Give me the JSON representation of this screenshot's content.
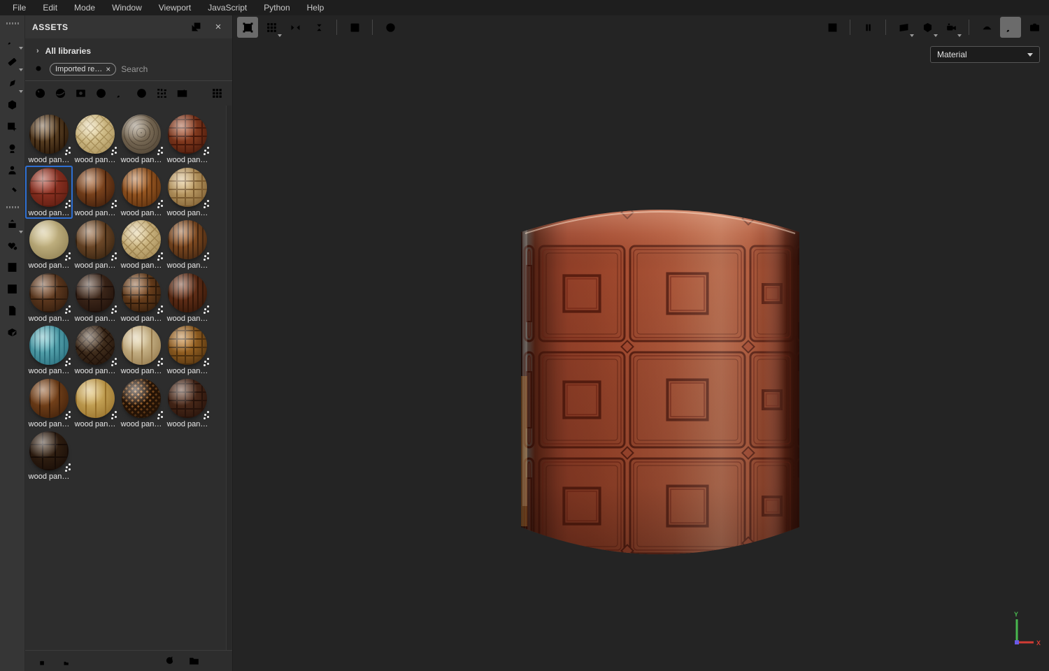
{
  "menu_bar": {
    "items": [
      "File",
      "Edit",
      "Mode",
      "Window",
      "Viewport",
      "JavaScript",
      "Python",
      "Help"
    ]
  },
  "left_toolbar": {
    "tools": [
      {
        "name": "paint-tool",
        "icon": "brush",
        "chev": true
      },
      {
        "name": "eraser-tool",
        "icon": "eraser",
        "chev": true
      },
      {
        "name": "projection-tool",
        "icon": "pen",
        "chev": true
      },
      {
        "name": "polygon-fill-tool",
        "icon": "polyfill"
      },
      {
        "name": "smudge-tool",
        "icon": "smudge"
      },
      {
        "name": "clone-tool",
        "icon": "clone"
      },
      {
        "name": "stamp-tool",
        "icon": "stamp"
      },
      {
        "name": "material-picker-tool",
        "icon": "picker"
      }
    ],
    "lower_tools": [
      {
        "name": "export-textures",
        "icon": "export",
        "chev": true
      },
      {
        "name": "resources-updater",
        "icon": "heart"
      },
      {
        "name": "history-tool",
        "icon": "hourglass",
        "dim": true
      },
      {
        "name": "transform-tool",
        "icon": "expand",
        "dim": true
      },
      {
        "name": "document-resources",
        "icon": "page"
      },
      {
        "name": "library-package",
        "icon": "package"
      }
    ]
  },
  "top_toolbar": {
    "left": [
      {
        "name": "marquee-projection",
        "icon": "marquee",
        "active": true
      },
      {
        "name": "tiling-mode",
        "icon": "tilegrid",
        "chev": true
      },
      {
        "name": "mirror-horizontal",
        "icon": "mirrorx"
      },
      {
        "name": "mirror-vertical",
        "icon": "mirrory"
      },
      {
        "sep": true
      },
      {
        "name": "add-frame",
        "icon": "addframe"
      },
      {
        "sep": true
      },
      {
        "name": "symmetry-off",
        "icon": "nosym"
      }
    ],
    "right": [
      {
        "name": "lazy-mouse-off",
        "icon": "lassooff"
      },
      {
        "sep": true
      },
      {
        "name": "pause-engine",
        "icon": "pause"
      },
      {
        "sep": true
      },
      {
        "name": "projection-view",
        "icon": "plane",
        "chev": true
      },
      {
        "name": "mesh-view",
        "icon": "cube",
        "chev": true
      },
      {
        "name": "camera-view",
        "icon": "videocam",
        "chev": true
      },
      {
        "sep": true
      },
      {
        "name": "environment-settings",
        "icon": "shell"
      },
      {
        "name": "paint-mode",
        "icon": "brush",
        "active": true
      },
      {
        "name": "screenshot",
        "icon": "photocam"
      }
    ]
  },
  "assets_panel": {
    "title": "ASSETS",
    "header_buttons": [
      "float-panel",
      "close-panel"
    ],
    "close_glyph": "×",
    "library_selector": "All libraries",
    "library_chevron": "›",
    "search": {
      "tag": "Imported re…",
      "tag_close": "×",
      "placeholder": "Search"
    },
    "filters": [
      {
        "name": "filter-materials",
        "icon": "sphere",
        "active": true
      },
      {
        "name": "filter-smart-materials",
        "icon": "sphere2"
      },
      {
        "name": "filter-smart-masks",
        "icon": "smask"
      },
      {
        "name": "filter-filters",
        "icon": "halfcircle"
      },
      {
        "name": "filter-brushes",
        "icon": "brush"
      },
      {
        "name": "filter-environments",
        "icon": "meshsphere"
      },
      {
        "name": "filter-procedurals",
        "icon": "patterngrid"
      },
      {
        "name": "filter-textures",
        "icon": "imagespark"
      }
    ],
    "view_mode_icon": "grid9",
    "selected_index": 4,
    "items": [
      {
        "label": "wood pan…",
        "base": "#7a5a34",
        "dark": "#241406",
        "pattern": "ribs"
      },
      {
        "label": "wood pan…",
        "base": "#ead9a6",
        "dark": "#a8905a",
        "pattern": "diamond"
      },
      {
        "label": "wood pan…",
        "base": "#93836b",
        "dark": "#4e4233",
        "pattern": "rings"
      },
      {
        "label": "wood pan…",
        "base": "#a84e2a",
        "dark": "#46180a",
        "pattern": "grid"
      },
      {
        "label": "wood pan…",
        "base": "#a83c2c",
        "dark": "#5a1c10",
        "pattern": "squares"
      },
      {
        "label": "wood pan…",
        "base": "#a05a28",
        "dark": "#3c1c0a",
        "pattern": "planks"
      },
      {
        "label": "wood pan…",
        "base": "#b86c2c",
        "dark": "#5c300e",
        "pattern": "ribs"
      },
      {
        "label": "wood pan…",
        "base": "#dcbc80",
        "dark": "#7c5c30",
        "pattern": "grid"
      },
      {
        "label": "wood pan…",
        "base": "#d8c996",
        "dark": "#8f7f52",
        "pattern": "plain"
      },
      {
        "label": "wood pan…",
        "base": "#8f6038",
        "dark": "#33200e",
        "pattern": "planks"
      },
      {
        "label": "wood pan…",
        "base": "#e6d29e",
        "dark": "#a08652",
        "pattern": "diamond"
      },
      {
        "label": "wood pan…",
        "base": "#a5602a",
        "dark": "#3f2410",
        "pattern": "ribs"
      },
      {
        "label": "wood pan…",
        "base": "#7c4c2a",
        "dark": "#2e1a0c",
        "pattern": "squares"
      },
      {
        "label": "wood pan…",
        "base": "#4e3322",
        "dark": "#1e100a",
        "pattern": "squares"
      },
      {
        "label": "wood pan…",
        "base": "#8f5628",
        "dark": "#2e1a0a",
        "pattern": "grid"
      },
      {
        "label": "wood pan…",
        "base": "#7c3c20",
        "dark": "#321608",
        "pattern": "ribs"
      },
      {
        "label": "wood pan…",
        "base": "#6cc0c8",
        "dark": "#2a6e7c",
        "pattern": "ribs"
      },
      {
        "label": "wood pan…",
        "base": "#56402a",
        "dark": "#201209",
        "pattern": "diamond"
      },
      {
        "label": "wood pan…",
        "base": "#e2d2a8",
        "dark": "#94784a",
        "pattern": "planks"
      },
      {
        "label": "wood pan…",
        "base": "#c07e2e",
        "dark": "#4e300e",
        "pattern": "grid"
      },
      {
        "label": "wood pan…",
        "base": "#8f5222",
        "dark": "#3f200a",
        "pattern": "planks"
      },
      {
        "label": "wood pan…",
        "base": "#dcbc6c",
        "dark": "#96702a",
        "pattern": "planks"
      },
      {
        "label": "wood pan…",
        "base": "#c87c34",
        "dark": "#241306",
        "pattern": "checker"
      },
      {
        "label": "wood pan…",
        "base": "#5e3622",
        "dark": "#26120a",
        "pattern": "grid"
      },
      {
        "label": "wood pan…",
        "base": "#3f2a18",
        "dark": "#170c06",
        "pattern": "squares"
      }
    ],
    "footer": {
      "left": [
        {
          "name": "export-list-save",
          "icon": "listsave"
        },
        {
          "name": "export-list-folder",
          "icon": "listfolder"
        }
      ],
      "right": [
        {
          "name": "refresh-assets",
          "icon": "refresh"
        },
        {
          "name": "open-assets-folder",
          "icon": "folder"
        },
        {
          "name": "import-resources",
          "icon": "plus"
        }
      ]
    }
  },
  "viewport": {
    "shading_dropdown": "Material",
    "axis_gizmo": {
      "y_label": "Y",
      "x_label": "X",
      "y_color": "#49b84f",
      "x_color": "#d23c34",
      "origin_color": "#6a5ae8"
    },
    "model": {
      "type": "cylinder",
      "material": "wood panel - red squares",
      "material_colors": {
        "base": "#a8492e",
        "panel_dark": "#5a1e10",
        "frame": "#7c2c1a",
        "highlight": "#d98c64",
        "rim_gray": "#c8c4bd",
        "rim_orange": "#de9440",
        "shadow": "#2e0f09"
      }
    },
    "background": "#242424"
  }
}
